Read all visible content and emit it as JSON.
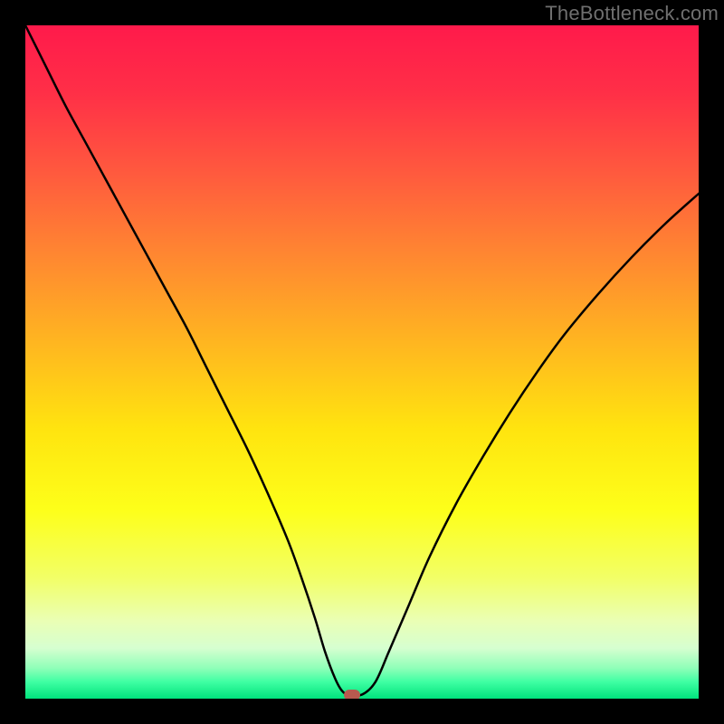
{
  "watermark": "TheBottleneck.com",
  "chart_data": {
    "type": "line",
    "title": "",
    "xlabel": "",
    "ylabel": "",
    "xlim": [
      0,
      100
    ],
    "ylim": [
      0,
      100
    ],
    "grid": false,
    "legend": false,
    "series": [
      {
        "name": "bottleneck-curve",
        "x": [
          0,
          3,
          6,
          9,
          12,
          15,
          18,
          21,
          24,
          27,
          30,
          33,
          36,
          39,
          41,
          43,
          44.5,
          46,
          47,
          48,
          50,
          52,
          54,
          57,
          60,
          64,
          68,
          72,
          76,
          80,
          85,
          90,
          95,
          100
        ],
        "y": [
          100,
          94,
          88,
          82.5,
          77,
          71.5,
          66,
          60.5,
          55,
          49,
          43,
          37,
          30.5,
          23.5,
          18,
          12,
          7,
          3,
          1.2,
          0.6,
          0.6,
          2.5,
          7,
          14,
          21,
          29,
          36,
          42.5,
          48.5,
          54,
          60,
          65.5,
          70.5,
          75
        ]
      }
    ],
    "marker": {
      "name": "bottleneck-point",
      "x": 48.5,
      "y": 0.6,
      "color": "#b85a4f"
    },
    "background_gradient": {
      "stops": [
        {
          "offset": 0.0,
          "color": "#ff1a4b"
        },
        {
          "offset": 0.1,
          "color": "#ff2f47"
        },
        {
          "offset": 0.22,
          "color": "#ff5a3e"
        },
        {
          "offset": 0.35,
          "color": "#ff8a30"
        },
        {
          "offset": 0.48,
          "color": "#ffb91f"
        },
        {
          "offset": 0.6,
          "color": "#ffe40f"
        },
        {
          "offset": 0.72,
          "color": "#fdff1a"
        },
        {
          "offset": 0.82,
          "color": "#f2ff66"
        },
        {
          "offset": 0.885,
          "color": "#eaffb5"
        },
        {
          "offset": 0.925,
          "color": "#d6ffd0"
        },
        {
          "offset": 0.955,
          "color": "#8effb8"
        },
        {
          "offset": 0.975,
          "color": "#3fffa3"
        },
        {
          "offset": 1.0,
          "color": "#00e37d"
        }
      ]
    }
  }
}
